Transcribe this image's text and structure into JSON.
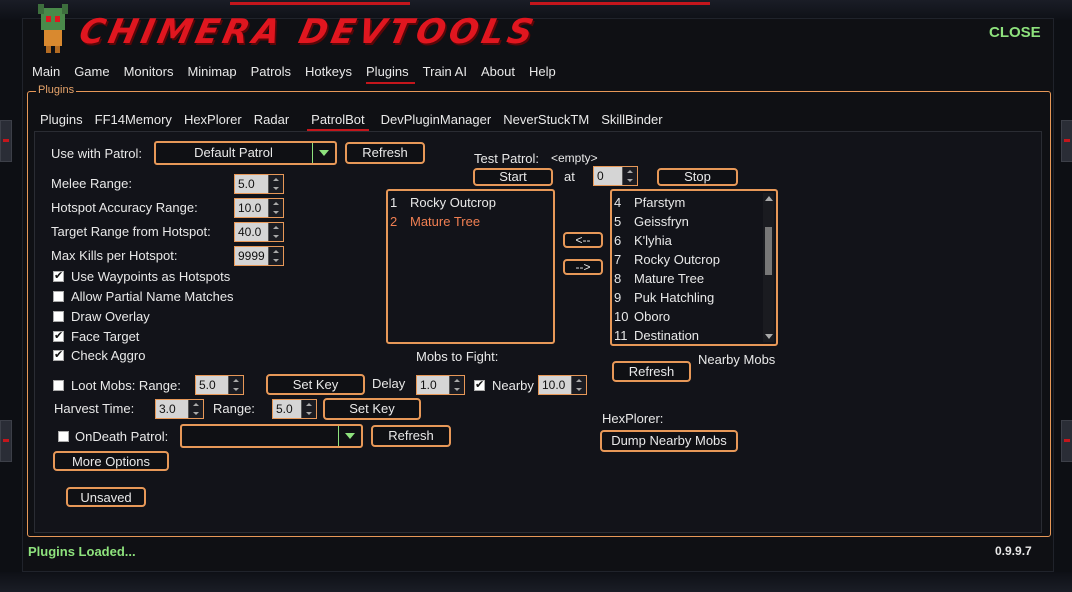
{
  "app": {
    "title": "CHIMERA DEVTOOLS",
    "close_label": "CLOSE"
  },
  "main_nav": [
    "Main",
    "Game",
    "Monitors",
    "Minimap",
    "Patrols",
    "Hotkeys",
    "Plugins",
    "Train AI",
    "About",
    "Help"
  ],
  "main_nav_active": "Plugins",
  "plugins_group_label": "Plugins",
  "sub_nav": [
    "Plugins",
    "FF14Memory",
    "HexPlorer",
    "Radar",
    "PatrolBot",
    "DevPluginManager",
    "NeverStuckTM",
    "SkillBinder"
  ],
  "sub_nav_active": "PatrolBot",
  "patrolbot": {
    "use_with_patrol_label": "Use with Patrol:",
    "use_with_patrol_value": "Default Patrol",
    "refresh_label": "Refresh",
    "melee_range_label": "Melee Range:",
    "melee_range_value": "5.0",
    "hotspot_accuracy_label": "Hotspot Accuracy Range:",
    "hotspot_accuracy_value": "10.0",
    "target_range_label": "Target Range from Hotspot:",
    "target_range_value": "40.0",
    "max_kills_label": "Max Kills per Hotspot:",
    "max_kills_value": "9999",
    "options": [
      {
        "label": "Use Waypoints as Hotspots",
        "checked": true
      },
      {
        "label": "Allow Partial Name Matches",
        "checked": false
      },
      {
        "label": "Draw Overlay",
        "checked": false
      },
      {
        "label": "Face Target",
        "checked": true
      },
      {
        "label": "Check Aggro",
        "checked": true
      }
    ],
    "loot_mobs_label": "Loot Mobs: Range:",
    "loot_mobs_checked": false,
    "loot_range_value": "5.0",
    "set_key_label": "Set Key",
    "delay_label": "Delay",
    "delay_value": "1.0",
    "nearby_label": "Nearby",
    "nearby_checked": true,
    "nearby_value": "10.0",
    "harvest_time_label": "Harvest Time:",
    "harvest_time_value": "3.0",
    "range_label": "Range:",
    "harvest_range_value": "5.0",
    "harvest_set_key_label": "Set Key",
    "ondeath_label": "OnDeath Patrol:",
    "ondeath_checked": false,
    "ondeath_value": "",
    "ondeath_refresh_label": "Refresh",
    "more_options_label": "More Options",
    "unsaved_label": "Unsaved",
    "test_patrol_label": "Test Patrol:",
    "test_patrol_value": "<empty>",
    "start_label": "Start",
    "at_label": "at",
    "at_value": "0",
    "stop_label": "Stop",
    "mobs_to_fight_label": "Mobs to Fight:",
    "mobs_to_fight": [
      {
        "n": "1",
        "name": "Rocky Outcrop",
        "color": "#e9e9e9"
      },
      {
        "n": "2",
        "name": "Mature Tree",
        "color": "#f07f52"
      }
    ],
    "move_left_label": "<--",
    "move_right_label": "-->",
    "nearby_mobs_label": "Nearby Mobs",
    "nearby_mobs": [
      {
        "n": "4",
        "name": "Pfarstym"
      },
      {
        "n": "5",
        "name": "Geissfryn"
      },
      {
        "n": "6",
        "name": "K'lyhia"
      },
      {
        "n": "7",
        "name": "Rocky Outcrop"
      },
      {
        "n": "8",
        "name": "Mature Tree"
      },
      {
        "n": "9",
        "name": "Puk Hatchling"
      },
      {
        "n": "10",
        "name": "Oboro"
      },
      {
        "n": "11",
        "name": "Destination"
      }
    ],
    "nearby_refresh_label": "Refresh",
    "hexplorer_label": "HexPlorer:",
    "dump_nearby_label": "Dump Nearby Mobs"
  },
  "status_text": "Plugins Loaded...",
  "version": "0.9.9.7",
  "colors": {
    "accent": "#e79858",
    "brand_red": "#c4161c",
    "status_green": "#8ee27d"
  }
}
